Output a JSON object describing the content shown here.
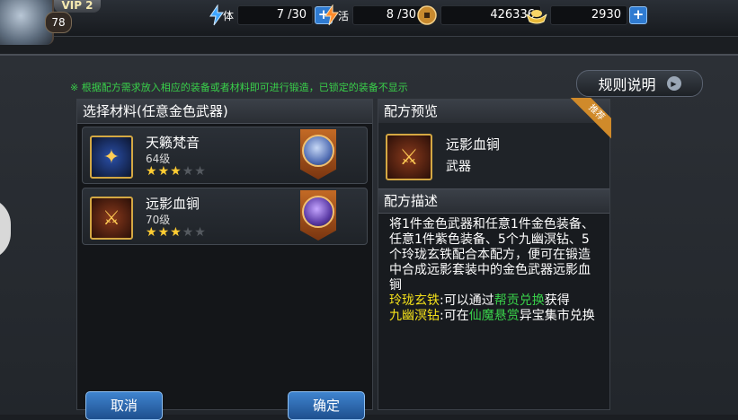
{
  "player": {
    "vip": "VIP 2",
    "level": "78"
  },
  "resources": {
    "stamina_label": "体",
    "stamina": "7 /30",
    "vitality_label": "活",
    "vitality": "8 /30",
    "coins": "426336",
    "gold": "2930"
  },
  "hint": "※ 根据配方需求放入相应的装备或者材料即可进行锻造，已锁定的装备不显示",
  "rules_button": "规则说明",
  "left_panel": {
    "title": "选择材料(任意金色武器)",
    "items": [
      {
        "name": "天籁梵音",
        "level": "64级",
        "stars_on": 3,
        "stars_total": 5
      },
      {
        "name": "远影血锏",
        "level": "70级",
        "stars_on": 3,
        "stars_total": 5
      }
    ],
    "cancel": "取消",
    "confirm": "确定"
  },
  "right_panel": {
    "preview_title": "配方预览",
    "tag": "推荐",
    "item_name": "远影血锏",
    "item_type": "武器",
    "desc_title": "配方描述",
    "desc_main": "将1件金色武器和任意1件金色装备、任意1件紫色装备、5个九幽溟钻、5个玲珑玄铁配合本配方，便可在锻造中合成远影套装中的金色武器远影血锏",
    "line1_a": "玲珑玄铁",
    "line1_b": ":可以通过",
    "line1_c": "帮贡兑换",
    "line1_d": "获得",
    "line2_a": "九幽溟钻",
    "line2_b": ":可在",
    "line2_c": "仙魔悬赏",
    "line2_d": "异宝集市兑换"
  }
}
